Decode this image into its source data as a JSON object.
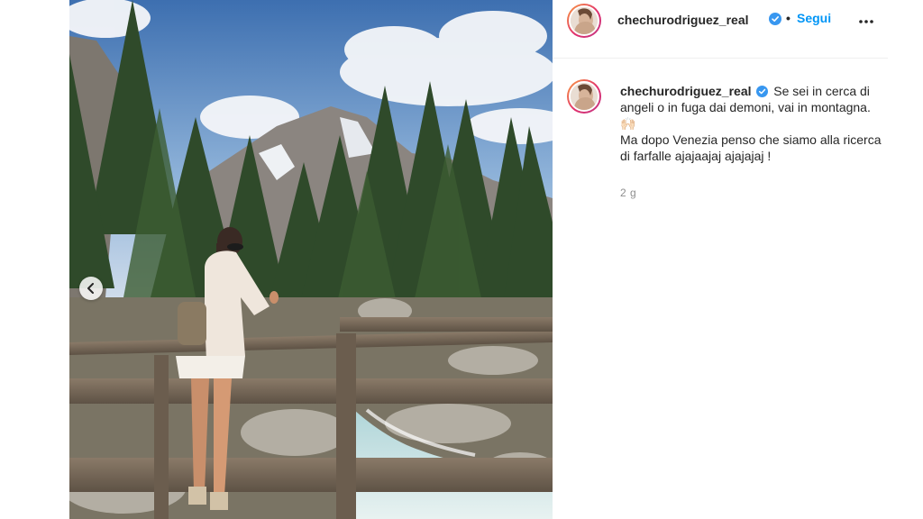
{
  "post": {
    "username": "chechurodriguez_real",
    "dot": "•",
    "follow_label": "Segui",
    "caption_text": "Se sei in cerca di angeli o in fuga dai demoni, vai in montagna.",
    "caption_emoji": "🙌🏻",
    "caption_line2": "Ma dopo Venezia penso che siamo alla ricerca di farfalle ajajaajaj ajajajaj !",
    "timestamp": "2 g"
  },
  "icons": {
    "verified": "verified-badge-icon",
    "more": "more-options-icon",
    "prev": "chevron-left-icon"
  },
  "colors": {
    "follow": "#0095f6",
    "verified": "#3897f0",
    "text": "#262626",
    "muted": "#8e8e8e"
  }
}
